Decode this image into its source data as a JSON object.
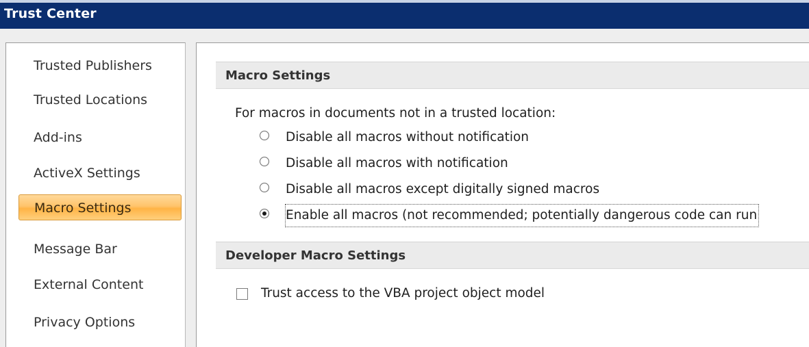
{
  "window": {
    "title": "Trust Center"
  },
  "sidebar": {
    "items": [
      {
        "label": "Trusted Publishers"
      },
      {
        "label": "Trusted Locations"
      },
      {
        "label": "Add-ins"
      },
      {
        "label": "ActiveX Settings"
      },
      {
        "label": "Macro Settings",
        "selected": true
      },
      {
        "label": "Message Bar"
      },
      {
        "label": "External Content"
      },
      {
        "label": "Privacy Options"
      }
    ]
  },
  "macro_settings": {
    "header": "Macro Settings",
    "prompt": "For macros in documents not in a trusted location:",
    "options": [
      {
        "label": "Disable all macros without notification",
        "checked": false
      },
      {
        "label": "Disable all macros with notification",
        "checked": false
      },
      {
        "label": "Disable all macros except digitally signed macros",
        "checked": false
      },
      {
        "label": "Enable all macros (not recommended; potentially dangerous code can run",
        "checked": true
      }
    ]
  },
  "developer": {
    "header": "Developer Macro Settings",
    "vba_label": "Trust access to the VBA project object model",
    "vba_checked": false
  },
  "colors": {
    "titlebar": "#0b2e6f",
    "selected_nav": "#ffc46b",
    "section_header_bg": "#ebebeb"
  }
}
